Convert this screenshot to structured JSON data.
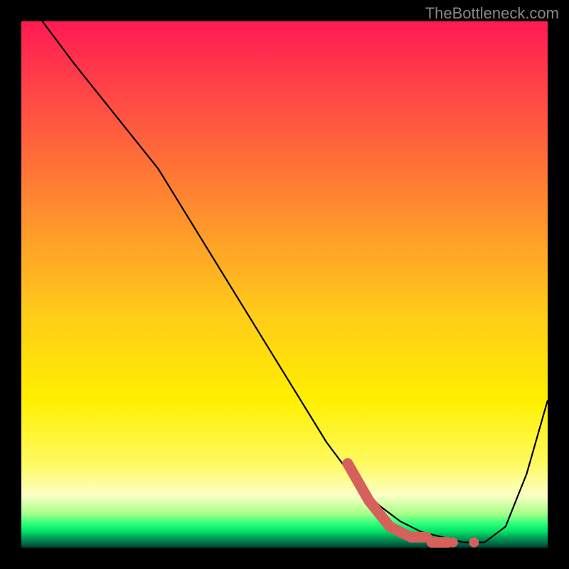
{
  "watermark": "TheBottleneck.com",
  "chart_data": {
    "type": "line",
    "title": "",
    "xlabel": "",
    "ylabel": "",
    "xlim": [
      0,
      100
    ],
    "ylim": [
      0,
      100
    ],
    "background_gradient": {
      "orientation": "vertical",
      "stops": [
        {
          "pos": 0,
          "color": "#ff1a52"
        },
        {
          "pos": 0.25,
          "color": "#ff6a3a"
        },
        {
          "pos": 0.55,
          "color": "#ffca1a"
        },
        {
          "pos": 0.84,
          "color": "#fffa60"
        },
        {
          "pos": 0.93,
          "color": "#a8ff8a"
        },
        {
          "pos": 0.97,
          "color": "#00e066"
        },
        {
          "pos": 1.0,
          "color": "#003a30"
        }
      ]
    },
    "series": [
      {
        "name": "main-curve",
        "color": "#000000",
        "style": "solid",
        "x": [
          4,
          10,
          18,
          26,
          34,
          42,
          50,
          58,
          64,
          68,
          72,
          76,
          80,
          84,
          88,
          92,
          96,
          100
        ],
        "y": [
          100,
          92,
          82,
          72,
          59,
          46,
          33,
          20,
          12,
          8,
          5,
          3,
          2,
          1,
          1,
          4,
          14,
          28
        ]
      },
      {
        "name": "highlight-dashed",
        "color": "#d6605b",
        "style": "dashed",
        "x": [
          62,
          66,
          70,
          74,
          78,
          82,
          86
        ],
        "y": [
          16,
          9,
          4,
          2,
          1,
          1,
          1
        ]
      }
    ],
    "annotations": []
  }
}
